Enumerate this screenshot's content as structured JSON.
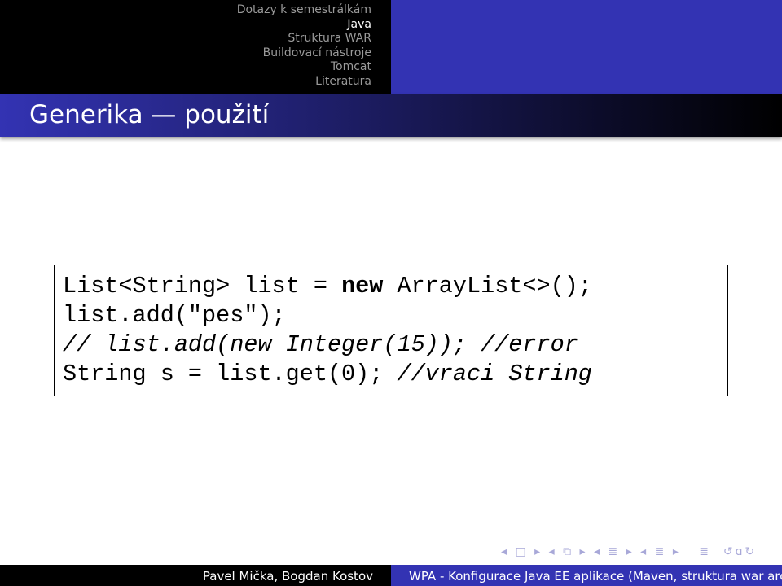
{
  "nav": {
    "sections": [
      "Dotazy k semestrálkám",
      "Java",
      "Struktura WAR",
      "Buildovací nástroje",
      "Tomcat",
      "Literatura"
    ],
    "current": "Java"
  },
  "slide": {
    "title": "Generika — použití"
  },
  "code": {
    "line1": {
      "a": "List<String> list = ",
      "kw": "new",
      "b": " ArrayList<>();"
    },
    "line2": "list.add(\"pes\");",
    "line3": "// list.add(new Integer(15)); //error",
    "line4": {
      "a": "String s = list.get(0); ",
      "comment": "//vraci String"
    }
  },
  "navigation_symbols": "◂ □ ▸ ◂ ⧉ ▸ ◂ ≣ ▸ ◂ ≣ ▸   ≣  ↺ɑ↻",
  "footer": {
    "authors": "Pavel Mička, Bogdan Kostov",
    "title": "WPA - Konfigurace Java EE aplikace (Maven, struktura war archivu)"
  },
  "colors": {
    "accent": "#3333b3",
    "header": "#000000"
  }
}
